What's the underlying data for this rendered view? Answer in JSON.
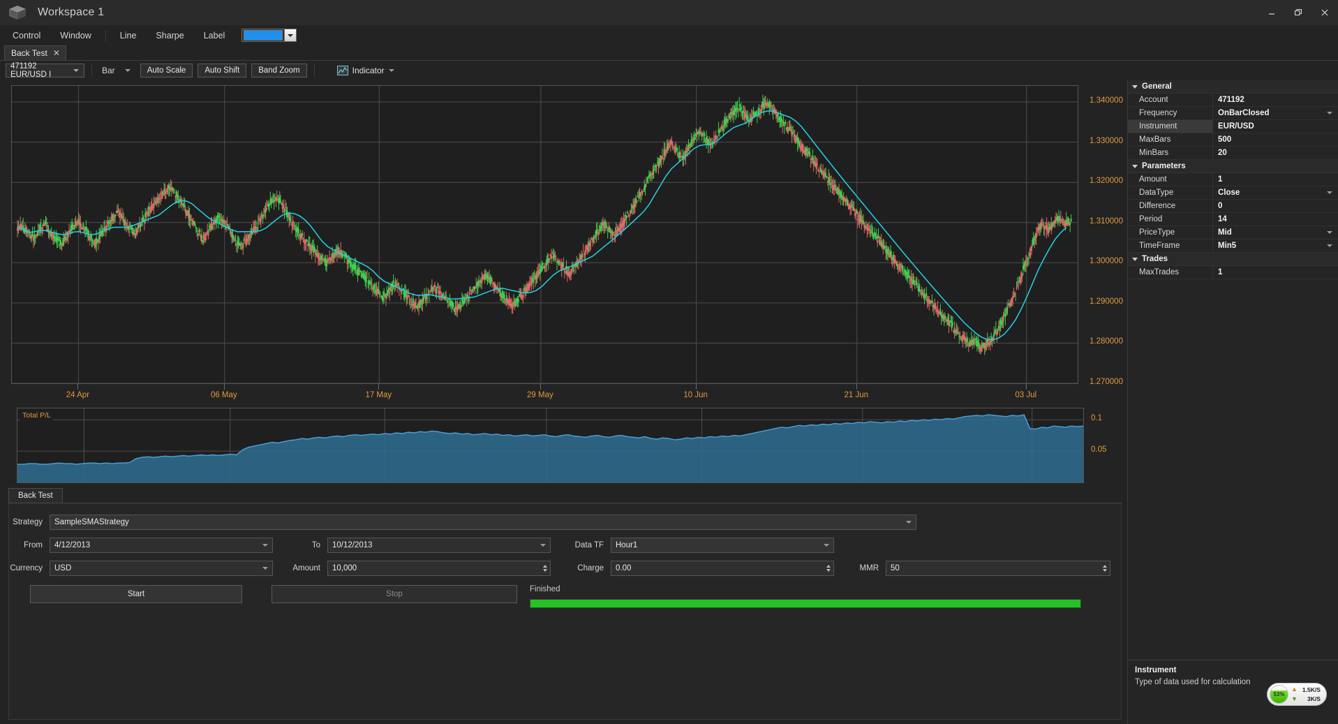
{
  "window": {
    "title": "Workspace 1",
    "logo_icon": "cube-icon",
    "minimize_icon": "minimize-icon",
    "restore_icon": "restore-icon",
    "close_icon": "close-icon"
  },
  "menu": {
    "items": [
      {
        "label": "Control"
      },
      {
        "label": "Window"
      },
      {
        "label": "Line"
      },
      {
        "label": "Sharpe"
      },
      {
        "label": "Label"
      }
    ],
    "color_value": "#1e90f0",
    "color_dropdown_icon": "chevron-down-icon"
  },
  "doc_tabs": [
    {
      "label": "Back Test",
      "close_icon": "close-icon"
    }
  ],
  "chart_toolbar": {
    "instrument_selector": "471192 EUR/USD I",
    "chart_type": "Bar",
    "auto_scale": "Auto Scale",
    "auto_shift": "Auto Shift",
    "band_zoom": "Band Zoom",
    "indicator": "Indicator",
    "indicator_icon": "chart-icon",
    "dropdown_icon": "chevron-down-icon"
  },
  "chart_data": [
    {
      "type": "line",
      "name": "price-chart",
      "title": "471192 EUR/USD I",
      "xlabel": "",
      "ylabel": "",
      "grid": true,
      "legend": "none",
      "ylim": [
        1.27,
        1.344
      ],
      "ytick_labels": [
        "1.340000",
        "1.330000",
        "1.320000",
        "1.310000",
        "1.300000",
        "1.290000",
        "1.280000",
        "1.270000"
      ],
      "ytick_values": [
        1.34,
        1.33,
        1.32,
        1.31,
        1.3,
        1.29,
        1.28,
        1.27
      ],
      "xtick_labels": [
        "24 Apr",
        "06 May",
        "17 May",
        "29 May",
        "10 Jun",
        "21 Jun",
        "03 Jul"
      ],
      "xtick_positions": [
        0.075,
        0.2395,
        0.4136,
        0.5956,
        0.7706,
        0.9515,
        1.1424
      ],
      "series": [
        {
          "name": "close",
          "values": [
            1.309,
            1.3075,
            1.3062,
            1.3081,
            1.3096,
            1.3074,
            1.3058,
            1.3043,
            1.3069,
            1.3088,
            1.3104,
            1.3086,
            1.3062,
            1.3049,
            1.3071,
            1.3093,
            1.3112,
            1.3128,
            1.3105,
            1.3086,
            1.3073,
            1.3094,
            1.3118,
            1.3139,
            1.3158,
            1.3172,
            1.319,
            1.3176,
            1.3152,
            1.3131,
            1.3108,
            1.3082,
            1.3059,
            1.3078,
            1.3098,
            1.3115,
            1.3097,
            1.3074,
            1.3053,
            1.3042,
            1.3061,
            1.3079,
            1.3103,
            1.3126,
            1.3148,
            1.3163,
            1.3147,
            1.3122,
            1.3098,
            1.3074,
            1.3057,
            1.3041,
            1.3027,
            1.3012,
            1.2998,
            1.3015,
            1.3033,
            1.3019,
            1.3002,
            1.2986,
            1.2971,
            1.2958,
            1.2943,
            1.2928,
            1.2914,
            1.2931,
            1.2948,
            1.2934,
            1.2919,
            1.2905,
            1.2893,
            1.2906,
            1.2922,
            1.2939,
            1.2925,
            1.2911,
            1.2897,
            1.2884,
            1.2899,
            1.2916,
            1.2934,
            1.2951,
            1.2968,
            1.2954,
            1.2938,
            1.2922,
            1.2907,
            1.2893,
            1.2909,
            1.2927,
            1.2946,
            1.2964,
            1.2982,
            1.3001,
            1.302,
            1.3004,
            1.2988,
            1.2973,
            1.2992,
            1.3012,
            1.3033,
            1.3054,
            1.3075,
            1.3097,
            1.3082,
            1.3064,
            1.3086,
            1.3109,
            1.3132,
            1.3156,
            1.318,
            1.3204,
            1.3228,
            1.3252,
            1.3276,
            1.3299,
            1.3278,
            1.3256,
            1.3281,
            1.3305,
            1.3328,
            1.3312,
            1.329,
            1.3311,
            1.3334,
            1.3356,
            1.3372,
            1.3388,
            1.3371,
            1.3352,
            1.3368,
            1.3385,
            1.3401,
            1.3384,
            1.3366,
            1.3348,
            1.333,
            1.3312,
            1.3294,
            1.3276,
            1.3258,
            1.324,
            1.3222,
            1.3205,
            1.3188,
            1.3171,
            1.3154,
            1.3137,
            1.312,
            1.3103,
            1.3086,
            1.3069,
            1.3052,
            1.3035,
            1.3018,
            1.3001,
            1.2984,
            1.2968,
            1.2952,
            1.2936,
            1.292,
            1.2904,
            1.2888,
            1.2872,
            1.2856,
            1.284,
            1.2824,
            1.2812,
            1.2796,
            1.2804,
            1.2788,
            1.2796,
            1.2812,
            1.2834,
            1.286,
            1.289,
            1.2925,
            1.2962,
            1.3,
            1.304,
            1.3078,
            1.3098,
            1.3082,
            1.3096,
            1.311,
            1.3095,
            1.3105
          ]
        }
      ],
      "notes": "OHLC candlestick chart with cyan moving-average overlay line. Green candles for up bars, red/salmon for down bars."
    },
    {
      "type": "area",
      "name": "total-pl-chart",
      "title": "Total P/L",
      "grid": true,
      "ylim": [
        0.0,
        0.118
      ],
      "ytick_labels": [
        "0.1",
        "0.05"
      ],
      "ytick_values": [
        0.1,
        0.05
      ],
      "values": [
        0.029,
        0.029,
        0.03,
        0.03,
        0.029,
        0.029,
        0.03,
        0.031,
        0.03,
        0.03,
        0.029,
        0.03,
        0.031,
        0.031,
        0.03,
        0.031,
        0.03,
        0.031,
        0.031,
        0.032,
        0.038,
        0.04,
        0.041,
        0.04,
        0.041,
        0.042,
        0.041,
        0.042,
        0.043,
        0.042,
        0.043,
        0.044,
        0.043,
        0.044,
        0.043,
        0.044,
        0.045,
        0.044,
        0.052,
        0.056,
        0.058,
        0.06,
        0.062,
        0.064,
        0.063,
        0.065,
        0.067,
        0.068,
        0.07,
        0.069,
        0.071,
        0.072,
        0.071,
        0.073,
        0.074,
        0.073,
        0.075,
        0.076,
        0.075,
        0.076,
        0.077,
        0.076,
        0.078,
        0.077,
        0.079,
        0.078,
        0.08,
        0.079,
        0.081,
        0.08,
        0.082,
        0.081,
        0.079,
        0.078,
        0.079,
        0.077,
        0.078,
        0.076,
        0.077,
        0.078,
        0.076,
        0.077,
        0.075,
        0.076,
        0.074,
        0.075,
        0.076,
        0.074,
        0.075,
        0.076,
        0.074,
        0.073,
        0.075,
        0.076,
        0.074,
        0.073,
        0.072,
        0.074,
        0.075,
        0.073,
        0.072,
        0.074,
        0.075,
        0.073,
        0.072,
        0.071,
        0.073,
        0.07,
        0.069,
        0.071,
        0.07,
        0.068,
        0.069,
        0.071,
        0.07,
        0.072,
        0.071,
        0.073,
        0.072,
        0.074,
        0.073,
        0.075,
        0.074,
        0.076,
        0.078,
        0.08,
        0.082,
        0.084,
        0.086,
        0.088,
        0.087,
        0.089,
        0.091,
        0.09,
        0.092,
        0.091,
        0.093,
        0.092,
        0.094,
        0.093,
        0.095,
        0.094,
        0.096,
        0.095,
        0.097,
        0.096,
        0.095,
        0.097,
        0.096,
        0.098,
        0.097,
        0.099,
        0.098,
        0.1,
        0.099,
        0.101,
        0.1,
        0.102,
        0.101,
        0.103,
        0.105,
        0.106,
        0.107,
        0.106,
        0.108,
        0.107,
        0.106,
        0.105,
        0.107,
        0.106,
        0.108,
        0.086,
        0.085,
        0.088,
        0.087,
        0.09,
        0.089,
        0.088,
        0.09,
        0.089,
        0.09
      ],
      "color": "#2f7fbf",
      "fill_color": "#2f6e92"
    }
  ],
  "backtest_panel": {
    "tab_label": "Back Test",
    "fields": {
      "strategy_label": "Strategy",
      "strategy_value": "SampleSMAStrategy",
      "from_label": "From",
      "from_value": "4/12/2013",
      "to_label": "To",
      "to_value": "10/12/2013",
      "datatf_label": "Data TF",
      "datatf_value": "Hour1",
      "currency_label": "Currency",
      "currency_value": "USD",
      "amount_label": "Amount",
      "amount_value": "10,000",
      "charge_label": "Charge",
      "charge_value": "0.00",
      "mmr_label": "MMR",
      "mmr_value": "50"
    },
    "start_button": "Start",
    "stop_button": "Stop",
    "status": "Finished",
    "progress_percent": 100,
    "progress_color": "#22c522"
  },
  "properties": {
    "groups": [
      {
        "name": "General",
        "rows": [
          {
            "key": "Account",
            "value": "471192",
            "dropdown": false,
            "selected": false
          },
          {
            "key": "Frequency",
            "value": "OnBarClosed",
            "dropdown": true,
            "selected": false
          },
          {
            "key": "Instrument",
            "value": "EUR/USD",
            "dropdown": false,
            "selected": true
          },
          {
            "key": "MaxBars",
            "value": "500",
            "dropdown": false,
            "selected": false
          },
          {
            "key": "MinBars",
            "value": "20",
            "dropdown": false,
            "selected": false
          }
        ]
      },
      {
        "name": "Parameters",
        "rows": [
          {
            "key": "Amount",
            "value": "1",
            "dropdown": false,
            "selected": false
          },
          {
            "key": "DataType",
            "value": "Close",
            "dropdown": true,
            "selected": false
          },
          {
            "key": "Difference",
            "value": "0",
            "dropdown": false,
            "selected": false
          },
          {
            "key": "Period",
            "value": "14",
            "dropdown": false,
            "selected": false
          },
          {
            "key": "PriceType",
            "value": "Mid",
            "dropdown": true,
            "selected": false
          },
          {
            "key": "TimeFrame",
            "value": "Min5",
            "dropdown": true,
            "selected": false
          }
        ]
      },
      {
        "name": "Trades",
        "rows": [
          {
            "key": "MaxTrades",
            "value": "1",
            "dropdown": false,
            "selected": false
          }
        ]
      }
    ],
    "description": {
      "title": "Instrument",
      "text": "Type of data used for calculation"
    }
  },
  "network_widget": {
    "percent": "53%",
    "upload": "1.5K/S",
    "download": "3K/S",
    "upload_icon": "arrow-up-icon",
    "download_icon": "arrow-down-icon"
  }
}
